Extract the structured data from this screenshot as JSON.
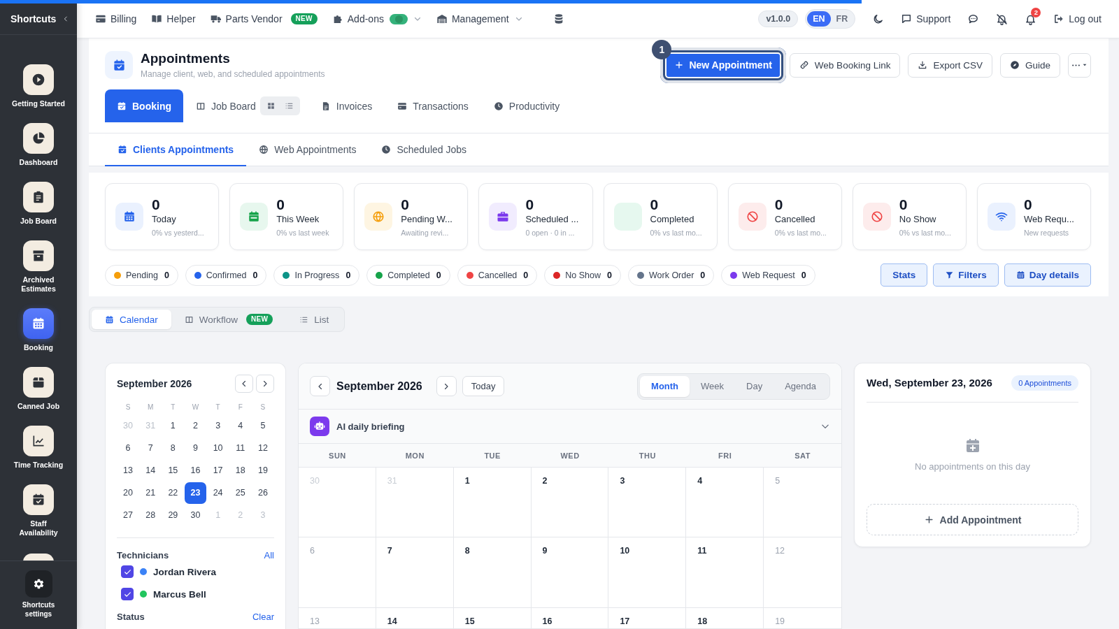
{
  "loading_bar": {
    "level": 0.77
  },
  "sidebar": {
    "title": "Shortcuts",
    "items": [
      {
        "label": "Getting Started",
        "selected": false
      },
      {
        "label": "Dashboard",
        "selected": false
      },
      {
        "label": "Job Board",
        "selected": false
      },
      {
        "label": "Archived Estimates",
        "selected": false
      },
      {
        "label": "Booking",
        "selected": true
      },
      {
        "label": "Canned Job",
        "selected": false
      },
      {
        "label": "Time Tracking",
        "selected": false
      },
      {
        "label": "Staff Availability",
        "selected": false
      }
    ],
    "more_below": true,
    "settings": "Shortcuts settings"
  },
  "topbar": {
    "menu": [
      {
        "label": "Billing",
        "kind": "link"
      },
      {
        "label": "Helper",
        "kind": "link"
      },
      {
        "label": "Parts Vendor",
        "kind": "badge",
        "badge": "NEW"
      },
      {
        "label": "Add-ons",
        "kind": "toggle",
        "on": true
      },
      {
        "label": "Management",
        "kind": "dropdown"
      },
      {
        "kind": "icon"
      }
    ],
    "version": "v1.0.0",
    "languages": [
      {
        "label": "EN",
        "selected": true
      },
      {
        "label": "FR",
        "selected": false
      }
    ],
    "support": "Support",
    "notifications": "2",
    "logout": "Log out"
  },
  "header": {
    "title": "Appointments",
    "subtitle": "Manage client, web, and scheduled appointments",
    "primary_action": {
      "label": "New Appointment",
      "step": "1"
    },
    "actions": [
      {
        "label": "Web Booking Link"
      },
      {
        "label": "Export CSV"
      },
      {
        "label": "Guide"
      }
    ]
  },
  "tabs": [
    {
      "label": "Booking",
      "selected": true,
      "view_toggle": false
    },
    {
      "label": "Job Board",
      "selected": false,
      "view_toggle": true
    },
    {
      "label": "Invoices",
      "selected": false,
      "view_toggle": false
    },
    {
      "label": "Transactions",
      "selected": false,
      "view_toggle": false
    },
    {
      "label": "Productivity",
      "selected": false,
      "view_toggle": false
    }
  ],
  "subtabs": [
    {
      "label": "Clients Appointments",
      "selected": true
    },
    {
      "label": "Web Appointments",
      "selected": false
    },
    {
      "label": "Scheduled Jobs",
      "selected": false
    }
  ],
  "stats": [
    {
      "value": "0",
      "label": "Today",
      "note": "0% vs yesterd..."
    },
    {
      "value": "0",
      "label": "This Week",
      "note": "0% vs last week"
    },
    {
      "value": "0",
      "label": "Pending W...",
      "note": "Awaiting revi..."
    },
    {
      "value": "0",
      "label": "Scheduled ...",
      "note": "0 open · 0 in ..."
    },
    {
      "value": "0",
      "label": "Completed",
      "note": "0% vs last mo..."
    },
    {
      "value": "0",
      "label": "Cancelled",
      "note": "0% vs last mo..."
    },
    {
      "value": "0",
      "label": "No Show",
      "note": "0% vs last mo..."
    },
    {
      "value": "0",
      "label": "Web Requ...",
      "note": "New requests"
    }
  ],
  "status_chips": [
    {
      "label": "Pending",
      "count": "0",
      "color": "#f59e0b"
    },
    {
      "label": "Confirmed",
      "count": "0",
      "color": "#2563eb"
    },
    {
      "label": "In Progress",
      "count": "0",
      "color": "#0d9488"
    },
    {
      "label": "Completed",
      "count": "0",
      "color": "#16a34a"
    },
    {
      "label": "Cancelled",
      "count": "0",
      "color": "#ef4444"
    },
    {
      "label": "No Show",
      "count": "0",
      "color": "#dc2626"
    },
    {
      "label": "Work Order",
      "count": "0",
      "color": "#64748b"
    },
    {
      "label": "Web Request",
      "count": "0",
      "color": "#7c3aed"
    }
  ],
  "panel_buttons": [
    {
      "label": "Stats"
    },
    {
      "label": "Filters"
    },
    {
      "label": "Day details"
    }
  ],
  "views": [
    {
      "label": "Calendar",
      "selected": true
    },
    {
      "label": "Workflow",
      "selected": false,
      "badge": "NEW"
    },
    {
      "label": "List",
      "selected": false
    }
  ],
  "mini_calendar": {
    "month": "September 2026",
    "weekdays": [
      "S",
      "M",
      "T",
      "W",
      "T",
      "F",
      "S"
    ],
    "days": [
      {
        "label": "30",
        "in_month": false,
        "selected": false
      },
      {
        "label": "31",
        "in_month": false,
        "selected": false
      },
      {
        "label": "1",
        "in_month": true,
        "selected": false
      },
      {
        "label": "2",
        "in_month": true,
        "selected": false
      },
      {
        "label": "3",
        "in_month": true,
        "selected": false
      },
      {
        "label": "4",
        "in_month": true,
        "selected": false
      },
      {
        "label": "5",
        "in_month": true,
        "selected": false
      },
      {
        "label": "6",
        "in_month": true,
        "selected": false
      },
      {
        "label": "7",
        "in_month": true,
        "selected": false
      },
      {
        "label": "8",
        "in_month": true,
        "selected": false
      },
      {
        "label": "9",
        "in_month": true,
        "selected": false
      },
      {
        "label": "10",
        "in_month": true,
        "selected": false
      },
      {
        "label": "11",
        "in_month": true,
        "selected": false
      },
      {
        "label": "12",
        "in_month": true,
        "selected": false
      },
      {
        "label": "13",
        "in_month": true,
        "selected": false
      },
      {
        "label": "14",
        "in_month": true,
        "selected": false
      },
      {
        "label": "15",
        "in_month": true,
        "selected": false
      },
      {
        "label": "16",
        "in_month": true,
        "selected": false
      },
      {
        "label": "17",
        "in_month": true,
        "selected": false
      },
      {
        "label": "18",
        "in_month": true,
        "selected": false
      },
      {
        "label": "19",
        "in_month": true,
        "selected": false
      },
      {
        "label": "20",
        "in_month": true,
        "selected": false
      },
      {
        "label": "21",
        "in_month": true,
        "selected": false
      },
      {
        "label": "22",
        "in_month": true,
        "selected": false
      },
      {
        "label": "23",
        "in_month": true,
        "selected": true
      },
      {
        "label": "24",
        "in_month": true,
        "selected": false
      },
      {
        "label": "25",
        "in_month": true,
        "selected": false
      },
      {
        "label": "26",
        "in_month": true,
        "selected": false
      },
      {
        "label": "27",
        "in_month": true,
        "selected": false
      },
      {
        "label": "28",
        "in_month": true,
        "selected": false
      },
      {
        "label": "29",
        "in_month": true,
        "selected": false
      },
      {
        "label": "30",
        "in_month": true,
        "selected": false
      },
      {
        "label": "1",
        "in_month": false,
        "selected": false
      },
      {
        "label": "2",
        "in_month": false,
        "selected": false
      },
      {
        "label": "3",
        "in_month": false,
        "selected": false
      }
    ],
    "technicians_title": "Technicians",
    "technicians_link": "All",
    "technicians": [
      {
        "name": "Jordan Rivera",
        "checked": true,
        "color": "#3b82f6"
      },
      {
        "name": "Marcus Bell",
        "checked": true,
        "color": "#22c55e"
      }
    ],
    "status_title": "Status",
    "status_link": "Clear"
  },
  "calendar": {
    "month": "September 2026",
    "today_button": "Today",
    "modes": [
      {
        "label": "Month",
        "selected": true
      },
      {
        "label": "Week",
        "selected": false
      },
      {
        "label": "Day",
        "selected": false
      },
      {
        "label": "Agenda",
        "selected": false
      }
    ],
    "briefing": {
      "title": "AI daily briefing",
      "expanded": false
    },
    "weekdays": [
      "SUN",
      "MON",
      "TUE",
      "WED",
      "THU",
      "FRI",
      "SAT"
    ],
    "days": [
      {
        "label": "30",
        "in_month": false
      },
      {
        "label": "31",
        "in_month": false
      },
      {
        "label": "1",
        "in_month": true
      },
      {
        "label": "2",
        "in_month": true
      },
      {
        "label": "3",
        "in_month": true
      },
      {
        "label": "4",
        "in_month": true
      },
      {
        "label": "5",
        "in_month": true
      },
      {
        "label": "6",
        "in_month": true
      },
      {
        "label": "7",
        "in_month": true
      },
      {
        "label": "8",
        "in_month": true
      },
      {
        "label": "9",
        "in_month": true
      },
      {
        "label": "10",
        "in_month": true
      },
      {
        "label": "11",
        "in_month": true
      },
      {
        "label": "12",
        "in_month": true
      },
      {
        "label": "13",
        "in_month": true
      },
      {
        "label": "14",
        "in_month": true
      },
      {
        "label": "15",
        "in_month": true
      },
      {
        "label": "16",
        "in_month": true
      },
      {
        "label": "17",
        "in_month": true
      },
      {
        "label": "18",
        "in_month": true
      },
      {
        "label": "19",
        "in_month": true
      }
    ]
  },
  "day_panel": {
    "date": "Wed, September 23, 2026",
    "count": "0 Appointments",
    "empty": "No appointments on this day",
    "add": "Add Appointment"
  }
}
